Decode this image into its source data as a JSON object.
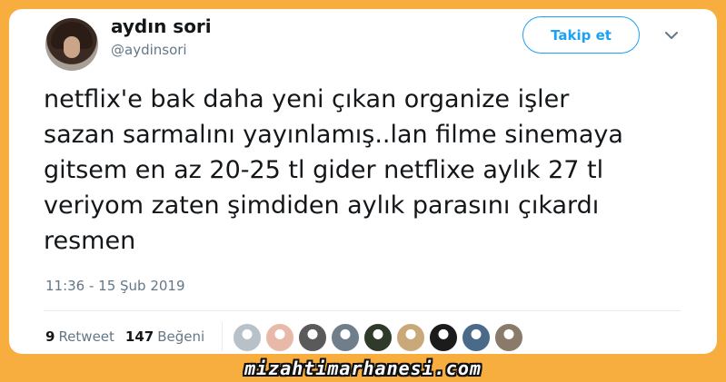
{
  "user": {
    "name": "aydın sori",
    "handle": "@aydinsori"
  },
  "follow_button": "Takip et",
  "tweet": {
    "text": "netflix'e bak daha yeni çıkan organize işler\nsazan sarmalını yayınlamış..lan filme sinemaya\ngitsem en az 20-25 tl gider netflixe aylık 27 tl\nveriyom zaten şimdiden aylık parasını çıkardı\nresmen",
    "timestamp": "11:36 - 15 Şub 2019"
  },
  "stats": {
    "retweet_count": "9",
    "retweet_label": "Retweet",
    "like_count": "147",
    "like_label": "Beğeni"
  },
  "likers": [
    {
      "color": "#b8c1c8"
    },
    {
      "color": "#e8b9a8"
    },
    {
      "color": "#5a5a5a"
    },
    {
      "color": "#6f7e8a"
    },
    {
      "color": "#2f3a2a"
    },
    {
      "color": "#c9a97a"
    },
    {
      "color": "#1b1b1b"
    },
    {
      "color": "#4a6a8a"
    },
    {
      "color": "#8a7a6a"
    }
  ],
  "watermark": "mizahtimarhanesi.com",
  "colors": {
    "frame": "#f8ad3f",
    "accent": "#1da1f2",
    "text": "#14171a",
    "muted": "#657786"
  },
  "icons": {
    "menu": "chevron-down-icon"
  }
}
